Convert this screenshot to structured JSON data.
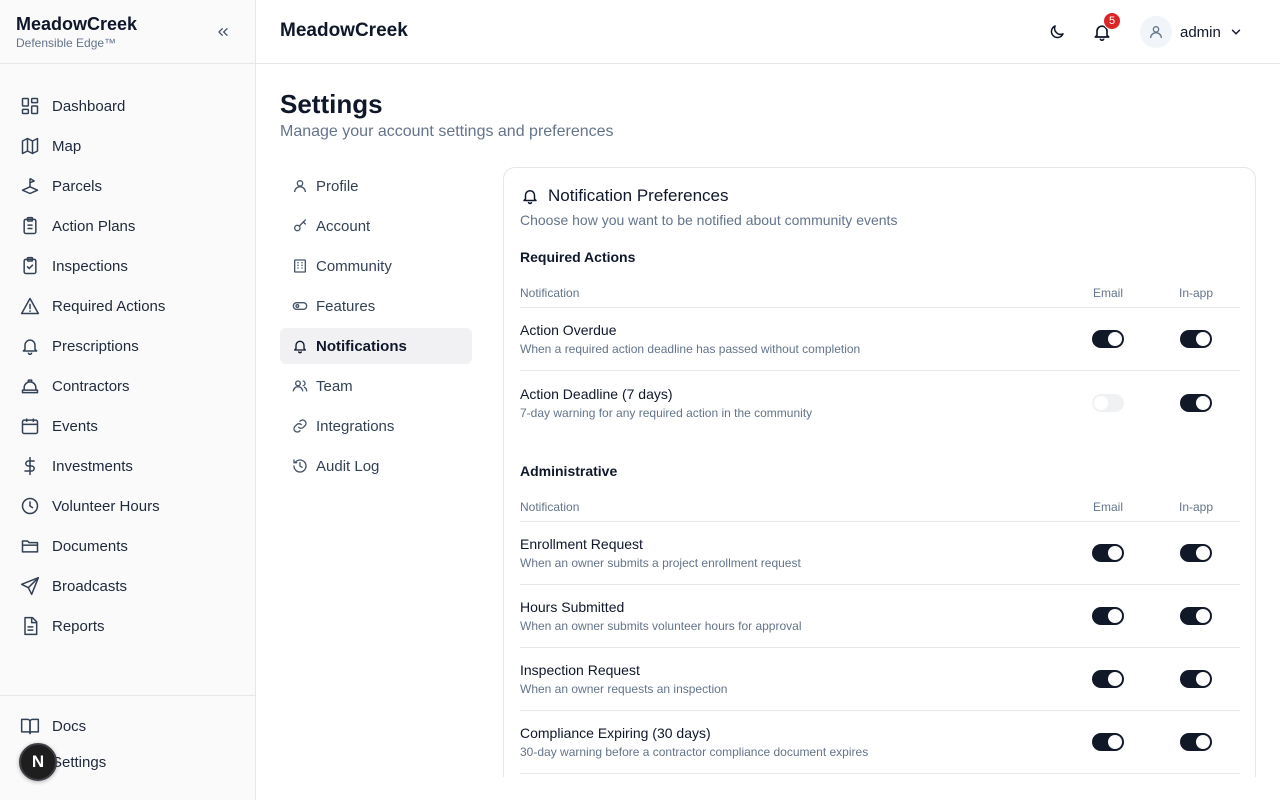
{
  "brand": {
    "name": "MeadowCreek",
    "tagline": "Defensible Edge™"
  },
  "sidebar": {
    "items": [
      {
        "label": "Dashboard",
        "icon": "dashboard-icon"
      },
      {
        "label": "Map",
        "icon": "map-icon"
      },
      {
        "label": "Parcels",
        "icon": "parcels-icon"
      },
      {
        "label": "Action Plans",
        "icon": "clipboard-icon"
      },
      {
        "label": "Inspections",
        "icon": "clipboard-check-icon"
      },
      {
        "label": "Required Actions",
        "icon": "warning-icon"
      },
      {
        "label": "Prescriptions",
        "icon": "bell-icon"
      },
      {
        "label": "Contractors",
        "icon": "hard-hat-icon"
      },
      {
        "label": "Events",
        "icon": "calendar-icon"
      },
      {
        "label": "Investments",
        "icon": "dollar-icon"
      },
      {
        "label": "Volunteer Hours",
        "icon": "clock-icon"
      },
      {
        "label": "Documents",
        "icon": "folder-icon"
      },
      {
        "label": "Broadcasts",
        "icon": "send-icon"
      },
      {
        "label": "Reports",
        "icon": "file-icon"
      }
    ],
    "bottom": [
      {
        "label": "Docs",
        "icon": "book-icon"
      },
      {
        "label": "Settings",
        "icon": "gear-icon"
      }
    ],
    "badge_letter": "N"
  },
  "topbar": {
    "title": "MeadowCreek",
    "notification_count": "5",
    "user": "admin"
  },
  "page": {
    "title": "Settings",
    "subtitle": "Manage your account settings and preferences"
  },
  "settings_nav": [
    {
      "label": "Profile",
      "icon": "user-icon",
      "active": false
    },
    {
      "label": "Account",
      "icon": "key-icon",
      "active": false
    },
    {
      "label": "Community",
      "icon": "building-icon",
      "active": false
    },
    {
      "label": "Features",
      "icon": "toggle-icon",
      "active": false
    },
    {
      "label": "Notifications",
      "icon": "bell-icon",
      "active": true
    },
    {
      "label": "Team",
      "icon": "users-icon",
      "active": false
    },
    {
      "label": "Integrations",
      "icon": "link-icon",
      "active": false
    },
    {
      "label": "Audit Log",
      "icon": "history-icon",
      "active": false
    }
  ],
  "card": {
    "title": "Notification Preferences",
    "description": "Choose how you want to be notified about community events",
    "columns": {
      "notification": "Notification",
      "email": "Email",
      "inapp": "In-app"
    },
    "sections": [
      {
        "title": "Required Actions",
        "rows": [
          {
            "name": "Action Overdue",
            "desc": "When a required action deadline has passed without completion",
            "email": true,
            "inapp": true
          },
          {
            "name": "Action Deadline (7 days)",
            "desc": "7-day warning for any required action in the community",
            "email": false,
            "inapp": true
          }
        ]
      },
      {
        "title": "Administrative",
        "rows": [
          {
            "name": "Enrollment Request",
            "desc": "When an owner submits a project enrollment request",
            "email": true,
            "inapp": true
          },
          {
            "name": "Hours Submitted",
            "desc": "When an owner submits volunteer hours for approval",
            "email": true,
            "inapp": true
          },
          {
            "name": "Inspection Request",
            "desc": "When an owner requests an inspection",
            "email": true,
            "inapp": true
          },
          {
            "name": "Compliance Expiring (30 days)",
            "desc": "30-day warning before a contractor compliance document expires",
            "email": true,
            "inapp": true
          }
        ]
      }
    ]
  },
  "colors": {
    "toggle_on": "#111827",
    "toggle_off": "#e5e7eb",
    "badge": "#dc2626"
  }
}
